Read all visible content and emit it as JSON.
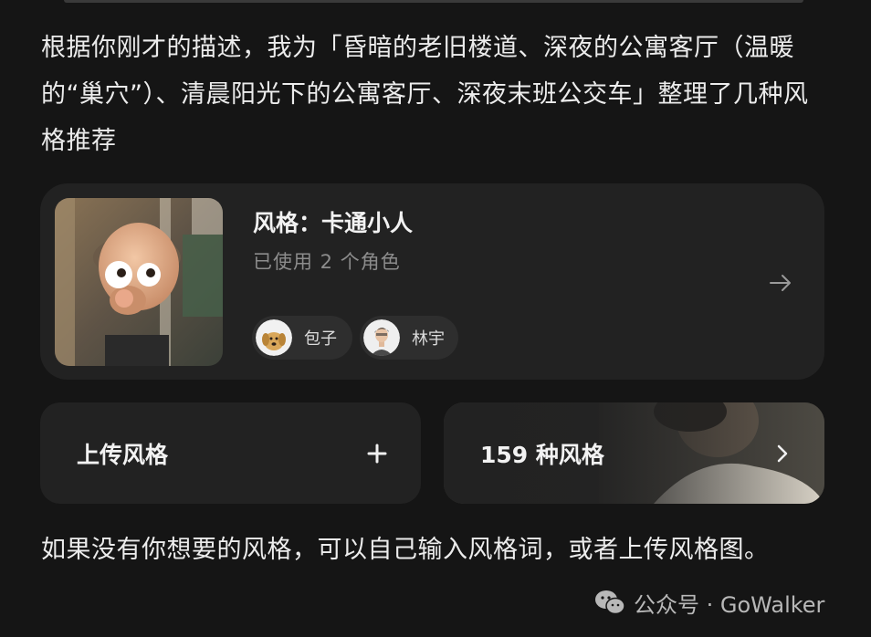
{
  "message": {
    "intro": "根据你刚才的描述，我为「昏暗的老旧楼道、深夜的公寓客厅（温暖的“巢穴”）、清晨阳光下的公寓客厅、深夜末班公交车」整理了几种风格推荐",
    "outro": "如果没有你想要的风格，可以自己输入风格词，或者上传风格图。"
  },
  "style_card": {
    "title": "风格：卡通小人",
    "subtitle": "已使用 2 个角色",
    "thumbnail_icon": "cartoon-character-thumbnail",
    "arrow_icon": "arrow-right-icon",
    "characters": [
      {
        "name": "包子",
        "avatar_icon": "dog-avatar"
      },
      {
        "name": "林宇",
        "avatar_icon": "man-avatar"
      }
    ]
  },
  "actions": {
    "upload_label": "上传风格",
    "upload_icon": "plus-icon",
    "browse_label": "159 种风格",
    "browse_icon": "chevron-right-icon"
  },
  "watermark": {
    "text": "公众号 · GoWalker",
    "icon": "wechat-icon"
  },
  "colors": {
    "background": "#151515",
    "card": "#222222",
    "chip": "#2e2e2e",
    "text": "#ececec",
    "muted": "#8c8c8c"
  }
}
